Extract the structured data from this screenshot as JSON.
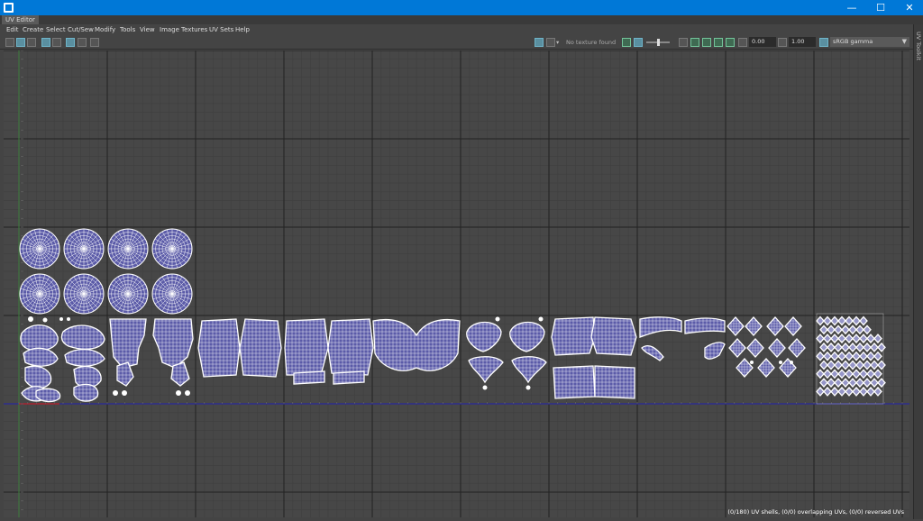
{
  "window": {
    "close_glyph": "✕",
    "maximize_glyph": "☐",
    "minimize_glyph": "—"
  },
  "panel": {
    "tab_label": "UV Editor",
    "toolkit_label": "UV Toolkit"
  },
  "menus": [
    "Edit",
    "Create",
    "Select",
    "Cut/Sew",
    "Modify",
    "Tools",
    "View",
    "Image",
    "Textures",
    "UV Sets",
    "Help"
  ],
  "toolbar": {
    "no_texture_text": "No texture found",
    "exposure_value": "0.00",
    "gamma_value": "1.00",
    "color_space": "sRGB gamma",
    "exposure_fraction": 0.5
  },
  "status": {
    "text": "(0/180) UV shells, (0/0) overlapping UVs, (0/0) reversed UVs"
  },
  "colors": {
    "title_bar": "#0078d7",
    "uv_fill": "#5b5ba8",
    "uv_wire": "#ffffff",
    "axis_u": "#2a2a9a",
    "axis_v": "#3e7e3e",
    "axis_origin": "#c02020"
  },
  "icons": [
    "maya-app-icon",
    "minimize-icon",
    "maximize-icon",
    "close-icon",
    "image-icon",
    "checker-icon",
    "exposure-icon",
    "gamma-icon",
    "color-space-icon"
  ]
}
